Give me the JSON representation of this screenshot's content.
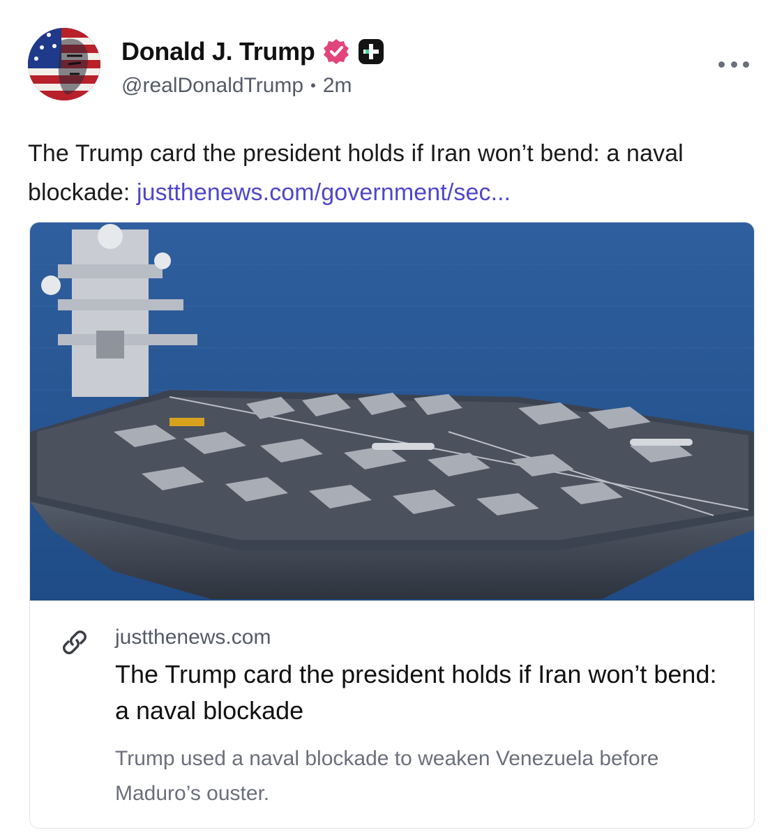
{
  "author": {
    "display_name": "Donald J. Trump",
    "handle": "@realDonaldTrump",
    "time_ago": "2m",
    "separator": "•"
  },
  "icons": {
    "verified": "verified-badge-icon",
    "plus": "plus-badge-icon",
    "more": "more-options-icon",
    "link": "link-icon"
  },
  "colors": {
    "link": "#4f46c8",
    "verified": "#e2457a",
    "muted_text": "#555a66"
  },
  "post": {
    "text": "The Trump card the president holds if Iran won’t bend: a naval blockade:",
    "link_text": "justthenews.com/government/sec..."
  },
  "card": {
    "domain": "justthenews.com",
    "title": "The Trump card the president holds if Iran won’t bend: a naval blockade",
    "description": "Trump used a naval blockade to weaken Venezuela before Maduro’s ouster."
  }
}
